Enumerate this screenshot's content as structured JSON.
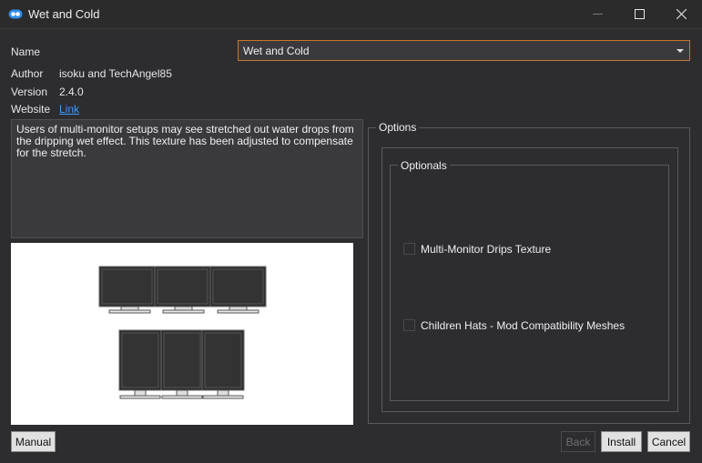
{
  "window": {
    "title": "Wet and Cold"
  },
  "form": {
    "name_label": "Name",
    "name_value": "Wet and Cold",
    "author_label": "Author",
    "author_value": "isoku and TechAngel85",
    "version_label": "Version",
    "version_value": "2.4.0",
    "website_label": "Website",
    "website_link": "Link"
  },
  "description": "Users of multi-monitor setups may see stretched out water drops from the dripping wet effect. This texture has been adjusted to compensate for the stretch.",
  "options": {
    "title": "Options",
    "group_title": "Optionals",
    "items": [
      {
        "label": "Multi-Monitor Drips Texture",
        "checked": false
      },
      {
        "label": "Children Hats - Mod Compatibility Meshes",
        "checked": false
      }
    ]
  },
  "buttons": {
    "manual": "Manual",
    "back": "Back",
    "install": "Install",
    "cancel": "Cancel"
  },
  "colors": {
    "background": "#2d2d30",
    "accent_border": "#c67828",
    "link": "#3b9cff"
  }
}
